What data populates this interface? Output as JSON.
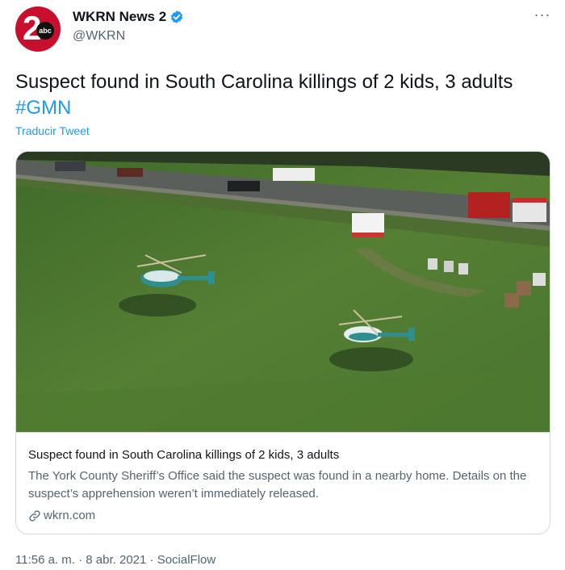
{
  "author": {
    "display_name": "WKRN News 2",
    "handle": "@WKRN",
    "avatar_text": "2",
    "avatar_badge": "abc",
    "verified": true
  },
  "more_label": "···",
  "tweet": {
    "text": "Suspect found in South Carolina killings of 2 kids, 3 adults ",
    "hashtag": "#GMN",
    "translate_label": "Traducir Tweet"
  },
  "card": {
    "title": "Suspect found in South Carolina killings of 2 kids, 3 adults",
    "description": "The York County Sheriff’s Office said the suspect was found in a nearby home. Details on the suspect’s apprehension weren’t immediately released.",
    "domain": "wkrn.com"
  },
  "footer": {
    "time": "11:56 a. m.",
    "separator": " · ",
    "date": "8 abr. 2021",
    "source": "SocialFlow"
  },
  "colors": {
    "accent": "#1d9bf0",
    "avatar_bg": "#c8102e",
    "text_primary": "#0f1419",
    "text_secondary": "#536471"
  }
}
